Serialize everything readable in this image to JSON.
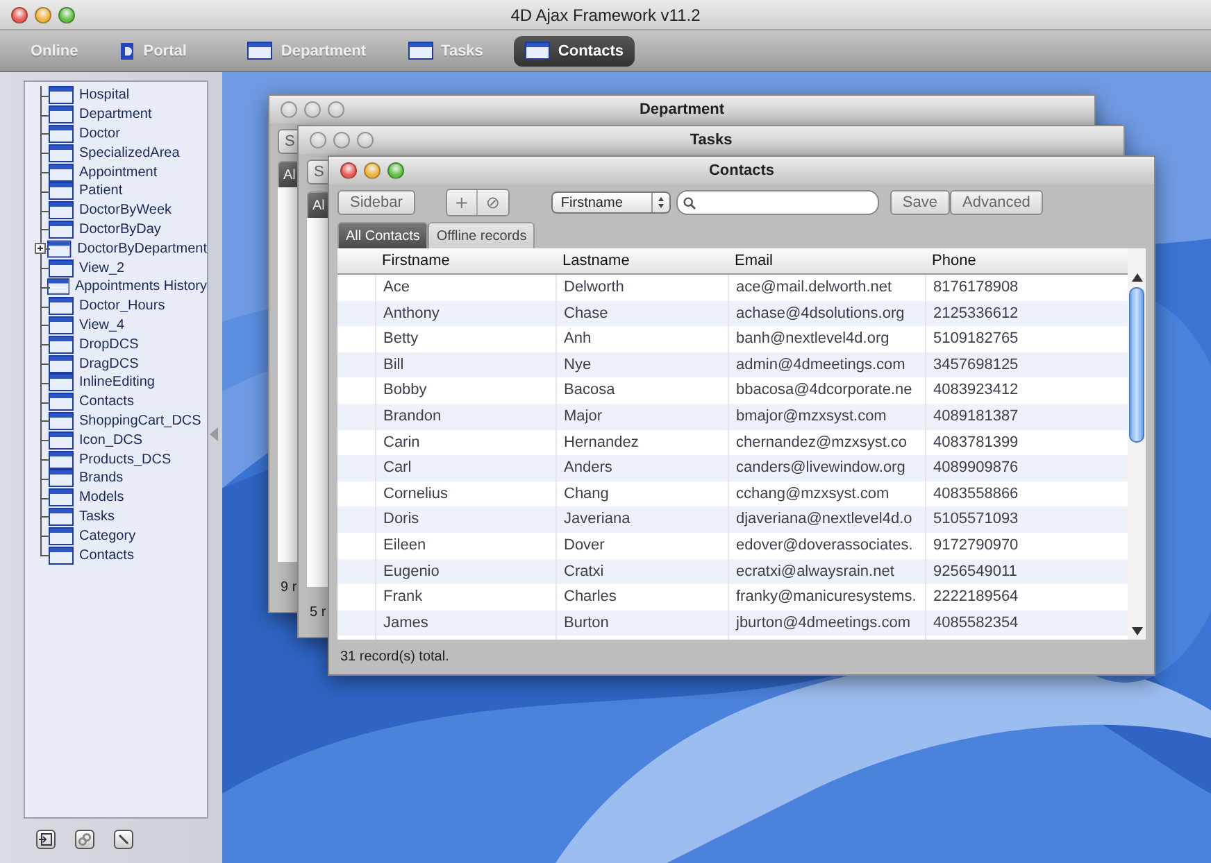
{
  "window": {
    "title": "4D Ajax Framework v11.2"
  },
  "toolbar": {
    "tabs": [
      {
        "label": "Online",
        "kind": "plain",
        "selected": false
      },
      {
        "label": "Portal",
        "kind": "portal",
        "selected": false
      },
      {
        "label": "Department",
        "kind": "window",
        "selected": false
      },
      {
        "label": "Tasks",
        "kind": "window",
        "selected": false
      },
      {
        "label": "Contacts",
        "kind": "window",
        "selected": true
      }
    ]
  },
  "sidebar": {
    "items": [
      {
        "label": "Hospital"
      },
      {
        "label": "Department"
      },
      {
        "label": "Doctor"
      },
      {
        "label": "SpecializedArea"
      },
      {
        "label": "Appointment"
      },
      {
        "label": "Patient"
      },
      {
        "label": "DoctorByWeek"
      },
      {
        "label": "DoctorByDay"
      },
      {
        "label": "DoctorByDepartment",
        "expanded": false
      },
      {
        "label": "View_2"
      },
      {
        "label": "Appointments History"
      },
      {
        "label": "Doctor_Hours"
      },
      {
        "label": "View_4"
      },
      {
        "label": "DropDCS"
      },
      {
        "label": "DragDCS"
      },
      {
        "label": "InlineEditing"
      },
      {
        "label": "Contacts"
      },
      {
        "label": "ShoppingCart_DCS"
      },
      {
        "label": "Icon_DCS"
      },
      {
        "label": "Products_DCS"
      },
      {
        "label": "Brands"
      },
      {
        "label": "Models"
      },
      {
        "label": "Tasks"
      },
      {
        "label": "Category"
      },
      {
        "label": "Contacts"
      }
    ]
  },
  "back_windows": [
    {
      "title": "Department",
      "active": false,
      "button": "S",
      "tab": "Al",
      "status": "9 r"
    },
    {
      "title": "Tasks",
      "active": false,
      "button": "S",
      "tab": "Al",
      "status": "5 r"
    }
  ],
  "contacts_window": {
    "title": "Contacts",
    "active": true,
    "toolbar": {
      "sidebar_button": "Sidebar",
      "add_button": "+",
      "delete_button": "⊘",
      "field_select": "Firstname",
      "save_button": "Save",
      "advanced_button": "Advanced"
    },
    "tabs": [
      {
        "label": "All Contacts",
        "selected": true
      },
      {
        "label": "Offline records",
        "selected": false
      }
    ],
    "table": {
      "columns": [
        "Firstname",
        "Lastname",
        "Email",
        "Phone"
      ],
      "rows": [
        [
          "Ace",
          "Delworth",
          "ace@mail.delworth.net",
          "8176178908"
        ],
        [
          "Anthony",
          "Chase",
          "achase@4dsolutions.org",
          "2125336612"
        ],
        [
          "Betty",
          "Anh",
          "banh@nextlevel4d.org",
          "5109182765"
        ],
        [
          "Bill",
          "Nye",
          "admin@4dmeetings.com",
          "3457698125"
        ],
        [
          "Bobby",
          "Bacosa",
          "bbacosa@4dcorporate.ne",
          "4083923412"
        ],
        [
          "Brandon",
          "Major",
          "bmajor@mzxsyst.com",
          "4089181387"
        ],
        [
          "Carin",
          "Hernandez",
          "chernandez@mzxsyst.co",
          "4083781399"
        ],
        [
          "Carl",
          "Anders",
          "canders@livewindow.org",
          "4089909876"
        ],
        [
          "Cornelius",
          "Chang",
          "cchang@mzxsyst.com",
          "4083558866"
        ],
        [
          "Doris",
          "Javeriana",
          "djaveriana@nextlevel4d.o",
          "5105571093"
        ],
        [
          "Eileen",
          "Dover",
          "edover@doverassociates.",
          "9172790970"
        ],
        [
          "Eugenio",
          "Cratxi",
          "ecratxi@alwaysrain.net",
          "9256549011"
        ],
        [
          "Frank",
          "Charles",
          "franky@manicuresystems.",
          "2222189564"
        ],
        [
          "James",
          "Burton",
          "jburton@4dmeetings.com",
          "4085582354"
        ]
      ]
    },
    "status": "31 record(s) total."
  }
}
